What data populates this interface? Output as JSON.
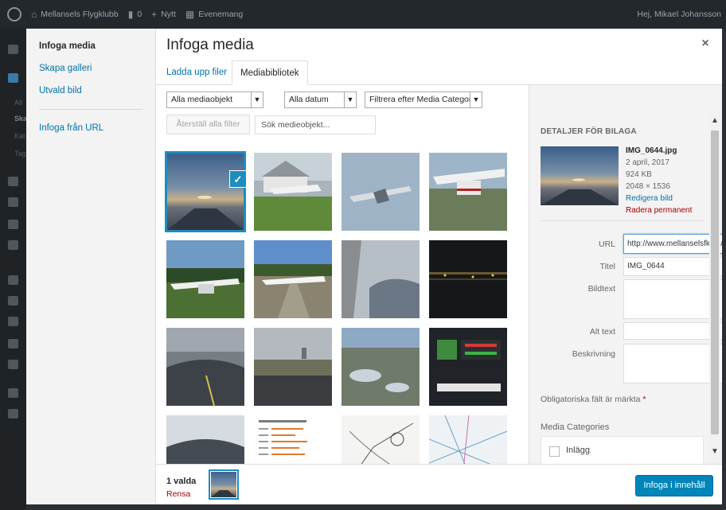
{
  "adminbar": {
    "site": "Mellansels Flygklubb",
    "comments": "0",
    "new": "Nytt",
    "events": "Evenemang",
    "greeting": "Hej, Mikael Johansson"
  },
  "adminmenu_fragments": [
    "All",
    "Ska",
    "Kat",
    "Tag"
  ],
  "menu": {
    "items": [
      "Infoga media",
      "Skapa galleri",
      "Utvald bild"
    ],
    "url_item": "Infoga från URL"
  },
  "modal": {
    "title": "Infoga media",
    "close_glyph": "×"
  },
  "tabs": [
    "Ladda upp filer",
    "Mediabibliotek"
  ],
  "toolbar": {
    "filter_type": "Alla mediaobjekt",
    "filter_date": "Alla datum",
    "filter_category": "Filtrera efter Media Category",
    "reset_button": "Återställ alla filter",
    "search_placeholder": "Sök medieobjekt..."
  },
  "attachments": [
    {
      "name": "IMG_0644",
      "selected": true
    },
    {
      "name": "aircraft-hangar"
    },
    {
      "name": "aircraft-in-flight"
    },
    {
      "name": "aircraft-on-apron"
    },
    {
      "name": "aircraft-forest-1"
    },
    {
      "name": "aircraft-runway"
    },
    {
      "name": "cockpit-clouds"
    },
    {
      "name": "night-lights"
    },
    {
      "name": "cockpit-glareshield"
    },
    {
      "name": "cockpit-taxi"
    },
    {
      "name": "aerial-lakes"
    },
    {
      "name": "instrument-panel"
    },
    {
      "name": "cockpit-runway"
    },
    {
      "name": "document-list"
    },
    {
      "name": "chart-map-1"
    },
    {
      "name": "chart-map-2"
    }
  ],
  "details": {
    "heading": "DETALJER FÖR BILAGA",
    "filename": "IMG_0644.jpg",
    "date": "2 april, 2017",
    "size": "924 KB",
    "dimensions": "2048 × 1536",
    "edit_link": "Redigera bild",
    "delete_link": "Radera permanent",
    "fields": {
      "url_label": "URL",
      "url_value": "http://www.mellanselsfk.se/",
      "title_label": "Titel",
      "title_value": "IMG_0644",
      "caption_label": "Bildtext",
      "alt_label": "Alt text",
      "desc_label": "Beskrivning"
    },
    "required_note": "Obligatoriska fält är märkta",
    "required_star": "*",
    "media_categories": "Media Categories",
    "category_item": "Inlägg"
  },
  "bottom": {
    "selected_count": "1 valda",
    "clear": "Rensa",
    "insert_button": "Infoga i innehåll"
  },
  "colors": {
    "link": "#0073aa",
    "primary_button": "#0085ba",
    "selection": "#1e8cbe",
    "delete": "#aa0000"
  }
}
